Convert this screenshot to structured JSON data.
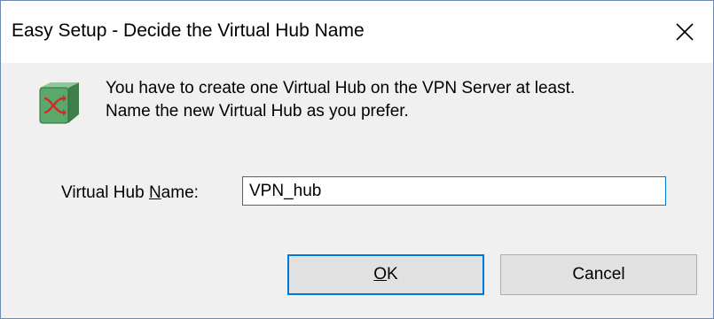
{
  "window": {
    "title": "Easy Setup - Decide the Virtual Hub Name",
    "close_icon": "close-icon"
  },
  "message": {
    "line1": "You have to create one Virtual Hub on the VPN Server at least.",
    "line2": "Name the new Virtual Hub as you prefer.",
    "icon": "virtual-hub-icon"
  },
  "form": {
    "label_prefix": "Virtual Hub ",
    "label_mnemonic": "N",
    "label_suffix": "ame:",
    "hub_name_value": "VPN_hub"
  },
  "buttons": {
    "ok_mnemonic": "O",
    "ok_rest": "K",
    "cancel_label": "Cancel"
  },
  "colors": {
    "accent": "#0078d7",
    "dialog_bg": "#f0f0f0",
    "button_bg": "#e1e1e1",
    "icon_green": "#5aa86a"
  }
}
